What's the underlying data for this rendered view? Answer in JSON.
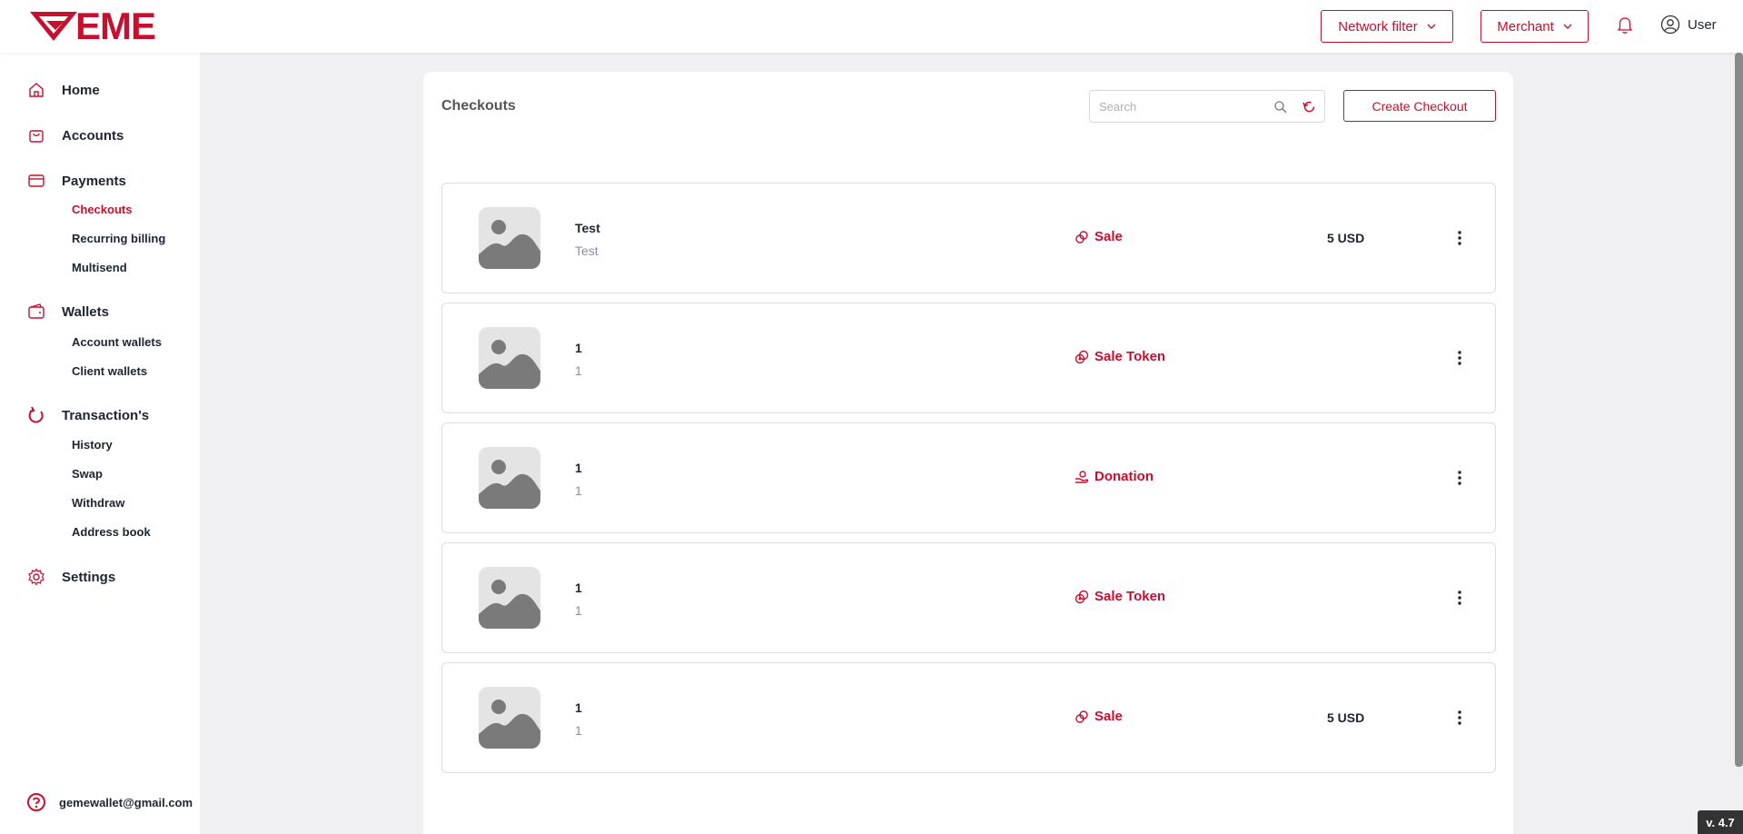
{
  "brand": {
    "logo_text": "EME",
    "accent": "#c8102e"
  },
  "header": {
    "network_filter_label": "Network filter",
    "merchant_label": "Merchant",
    "user_label": "User"
  },
  "sidebar": {
    "home": "Home",
    "accounts": "Accounts",
    "payments": "Payments",
    "payments_items": [
      "Checkouts",
      "Recurring billing",
      "Multisend"
    ],
    "wallets": "Wallets",
    "wallets_items": [
      "Account wallets",
      "Client wallets"
    ],
    "transactions": "Transaction's",
    "transactions_items": [
      "History",
      "Swap",
      "Withdraw",
      "Address book"
    ],
    "settings": "Settings",
    "help_email": "gemewallet@gmail.com"
  },
  "main": {
    "title": "Checkouts",
    "search_placeholder": "Search",
    "create_label": "Create Checkout",
    "rows": [
      {
        "title": "Test",
        "subtitle": "Test",
        "type": "Sale",
        "type_icon": "sale-icon",
        "amount": "5 USD"
      },
      {
        "title": "1",
        "subtitle": "1",
        "type": "Sale Token",
        "type_icon": "sale-token-icon",
        "amount": ""
      },
      {
        "title": "1",
        "subtitle": "1",
        "type": "Donation",
        "type_icon": "donation-icon",
        "amount": ""
      },
      {
        "title": "1",
        "subtitle": "1",
        "type": "Sale Token",
        "type_icon": "sale-token-icon",
        "amount": ""
      },
      {
        "title": "1",
        "subtitle": "1",
        "type": "Sale",
        "type_icon": "sale-icon",
        "amount": "5 USD"
      }
    ]
  },
  "version": "v. 4.7"
}
